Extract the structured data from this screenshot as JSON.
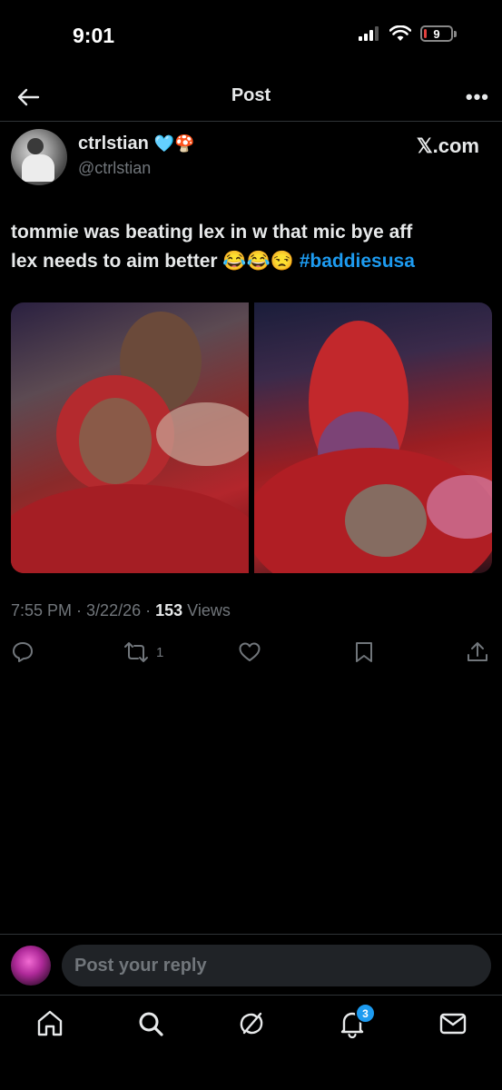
{
  "status_bar": {
    "time": "9:01",
    "battery": "9"
  },
  "header": {
    "title": "Post"
  },
  "author": {
    "display_name": "ctrlstian",
    "emoji": "🩵🍄",
    "handle": "@ctrlstian",
    "source": "𝕏.com"
  },
  "tweet": {
    "text_line1": "tommie was beating lex in w that mic bye aff",
    "text_line2": "lex needs to aim better 😂😂😒 ",
    "hashtag": "#baddiesusa"
  },
  "meta": {
    "time": "7:55 PM",
    "sep1": " · ",
    "date": "3/22/26",
    "sep2": " · ",
    "views_count": "153",
    "views_label": " Views"
  },
  "actions": {
    "retweet_count": "1"
  },
  "reply": {
    "placeholder": "Post your reply"
  },
  "nav": {
    "notifications_badge": "3"
  },
  "colors": {
    "accent": "#1d9bf0",
    "background": "#000000",
    "secondary_text": "#71767b",
    "battery_low": "#e0413e"
  },
  "icons": {
    "header": [
      "back-arrow-icon",
      "more-icon"
    ],
    "actions": [
      "reply-icon",
      "retweet-icon",
      "like-icon",
      "bookmark-icon",
      "share-icon"
    ],
    "nav": [
      "home-icon",
      "search-icon",
      "grok-icon",
      "bell-icon",
      "mail-icon"
    ]
  }
}
